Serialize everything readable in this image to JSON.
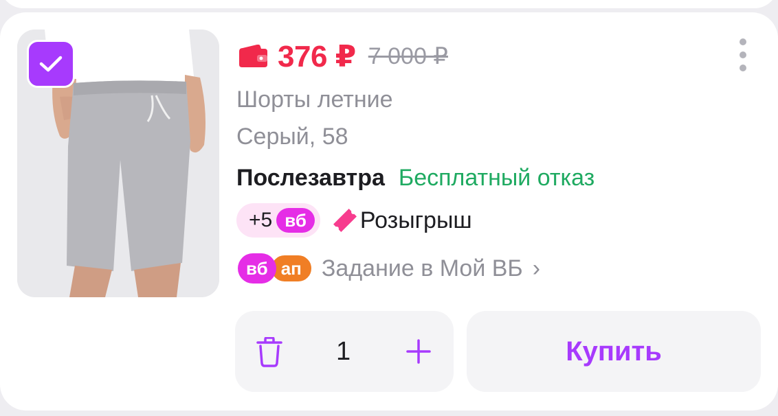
{
  "product": {
    "selected": true,
    "price": "376 ₽",
    "old_price": "7 000 ₽",
    "name": "Шорты летние",
    "variant": "Серый, 58",
    "delivery": "Послезавтра",
    "refund": "Бесплатный отказ"
  },
  "bonus": {
    "value": "+5",
    "badge": "вб",
    "raffle": "Розыгрыш"
  },
  "task": {
    "badge_wb": "вб",
    "badge_ap": "ап",
    "text": "Задание в Мой ВБ",
    "chevron": "›"
  },
  "cart_controls": {
    "quantity": "1",
    "buy_label": "Купить"
  },
  "colors": {
    "price": "#f1294b",
    "accent_purple": "#a73afd",
    "refund_green": "#1faa61",
    "wb_badge": "#e52de6",
    "ap_badge": "#f07e25"
  },
  "icons": {
    "wallet": "wallet-icon",
    "menu": "more-vertical-icon",
    "check": "check-icon",
    "ticket": "ticket-icon",
    "trash": "trash-icon",
    "plus": "plus-icon"
  }
}
